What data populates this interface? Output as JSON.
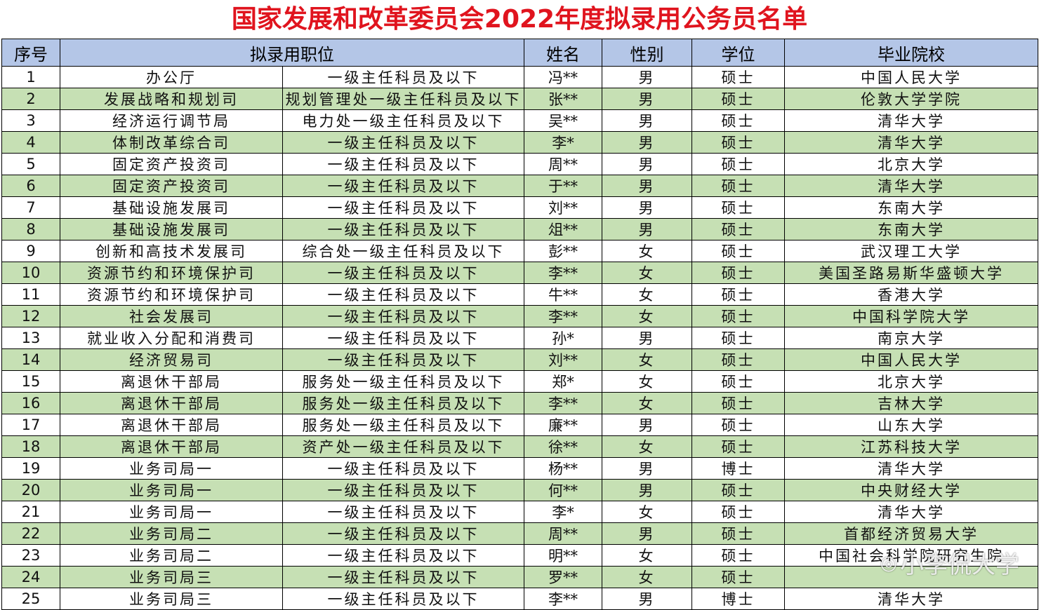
{
  "title": "国家发展和改革委员会2022年度拟录用公务员名单",
  "headers": {
    "seq": "序号",
    "position": "拟录用职位",
    "name": "姓名",
    "gender": "性别",
    "degree": "学位",
    "school": "毕业院校"
  },
  "rows": [
    {
      "seq": "1",
      "dept": "办公厅",
      "post": "一级主任科员及以下",
      "name": "冯**",
      "gender": "男",
      "degree": "硕士",
      "school": "中国人民大学"
    },
    {
      "seq": "2",
      "dept": "发展战略和规划司",
      "post": "规划管理处一级主任科员及以下",
      "name": "张**",
      "gender": "男",
      "degree": "硕士",
      "school": "伦敦大学学院"
    },
    {
      "seq": "3",
      "dept": "经济运行调节局",
      "post": "电力处一级主任科员及以下",
      "name": "吴**",
      "gender": "男",
      "degree": "硕士",
      "school": "清华大学"
    },
    {
      "seq": "4",
      "dept": "体制改革综合司",
      "post": "一级主任科员及以下",
      "name": "李*",
      "gender": "男",
      "degree": "硕士",
      "school": "清华大学"
    },
    {
      "seq": "5",
      "dept": "固定资产投资司",
      "post": "一级主任科员及以下",
      "name": "周**",
      "gender": "男",
      "degree": "硕士",
      "school": "北京大学"
    },
    {
      "seq": "6",
      "dept": "固定资产投资司",
      "post": "一级主任科员及以下",
      "name": "于**",
      "gender": "男",
      "degree": "硕士",
      "school": "清华大学"
    },
    {
      "seq": "7",
      "dept": "基础设施发展司",
      "post": "一级主任科员及以下",
      "name": "刘**",
      "gender": "男",
      "degree": "硕士",
      "school": "东南大学"
    },
    {
      "seq": "8",
      "dept": "基础设施发展司",
      "post": "一级主任科员及以下",
      "name": "俎**",
      "gender": "男",
      "degree": "硕士",
      "school": "东南大学"
    },
    {
      "seq": "9",
      "dept": "创新和高技术发展司",
      "post": "综合处一级主任科员及以下",
      "name": "彭**",
      "gender": "女",
      "degree": "硕士",
      "school": "武汉理工大学"
    },
    {
      "seq": "10",
      "dept": "资源节约和环境保护司",
      "post": "一级主任科员及以下",
      "name": "李**",
      "gender": "女",
      "degree": "硕士",
      "school": "美国圣路易斯华盛顿大学"
    },
    {
      "seq": "11",
      "dept": "资源节约和环境保护司",
      "post": "一级主任科员及以下",
      "name": "牛**",
      "gender": "女",
      "degree": "硕士",
      "school": "香港大学"
    },
    {
      "seq": "12",
      "dept": "社会发展司",
      "post": "一级主任科员及以下",
      "name": "李**",
      "gender": "女",
      "degree": "硕士",
      "school": "中国科学院大学"
    },
    {
      "seq": "13",
      "dept": "就业收入分配和消费司",
      "post": "一级主任科员及以下",
      "name": "孙*",
      "gender": "男",
      "degree": "硕士",
      "school": "南京大学"
    },
    {
      "seq": "14",
      "dept": "经济贸易司",
      "post": "一级主任科员及以下",
      "name": "刘**",
      "gender": "女",
      "degree": "硕士",
      "school": "中国人民大学"
    },
    {
      "seq": "15",
      "dept": "离退休干部局",
      "post": "服务处一级主任科员及以下",
      "name": "郑*",
      "gender": "女",
      "degree": "硕士",
      "school": "北京大学"
    },
    {
      "seq": "16",
      "dept": "离退休干部局",
      "post": "服务处一级主任科员及以下",
      "name": "李**",
      "gender": "女",
      "degree": "硕士",
      "school": "吉林大学"
    },
    {
      "seq": "17",
      "dept": "离退休干部局",
      "post": "服务处一级主任科员及以下",
      "name": "廉**",
      "gender": "男",
      "degree": "硕士",
      "school": "山东大学"
    },
    {
      "seq": "18",
      "dept": "离退休干部局",
      "post": "资产处一级主任科员及以下",
      "name": "徐**",
      "gender": "女",
      "degree": "硕士",
      "school": "江苏科技大学"
    },
    {
      "seq": "19",
      "dept": "业务司局一",
      "post": "一级主任科员及以下",
      "name": "杨**",
      "gender": "男",
      "degree": "博士",
      "school": "清华大学"
    },
    {
      "seq": "20",
      "dept": "业务司局一",
      "post": "一级主任科员及以下",
      "name": "何**",
      "gender": "男",
      "degree": "硕士",
      "school": "中央财经大学"
    },
    {
      "seq": "21",
      "dept": "业务司局一",
      "post": "一级主任科员及以下",
      "name": "李*",
      "gender": "女",
      "degree": "硕士",
      "school": "清华大学"
    },
    {
      "seq": "22",
      "dept": "业务司局二",
      "post": "一级主任科员及以下",
      "name": "周**",
      "gender": "男",
      "degree": "硕士",
      "school": "首都经济贸易大学"
    },
    {
      "seq": "23",
      "dept": "业务司局二",
      "post": "一级主任科员及以下",
      "name": "明**",
      "gender": "女",
      "degree": "硕士",
      "school": "中国社会科学院研究生院"
    },
    {
      "seq": "24",
      "dept": "业务司局三",
      "post": "一级主任科员及以下",
      "name": "罗**",
      "gender": "女",
      "degree": "硕士",
      "school": ""
    },
    {
      "seq": "25",
      "dept": "业务司局三",
      "post": "一级主任科员及以下",
      "name": "李**",
      "gender": "男",
      "degree": "博士",
      "school": "清华大学"
    }
  ],
  "watermark": {
    "icon": "weibo-icon",
    "text": "小李侃大学"
  },
  "colors": {
    "title": "#e0141e",
    "header_bg": "#b4c6e7",
    "stripe_bg": "#c6e0b4"
  }
}
